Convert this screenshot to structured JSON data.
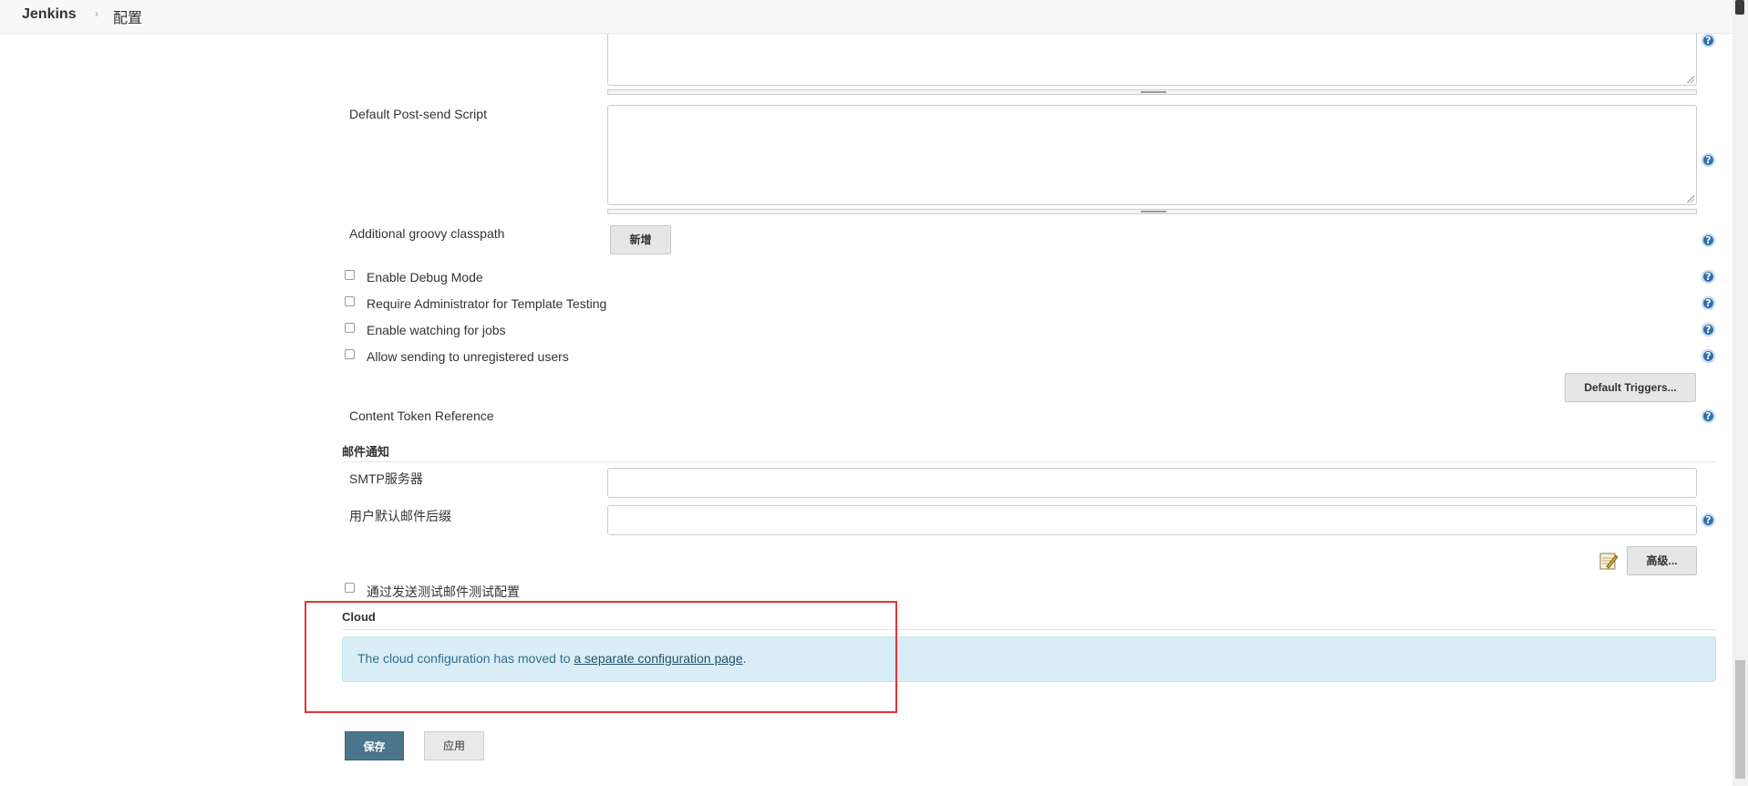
{
  "breadcrumb": {
    "root": "Jenkins",
    "separator": "›",
    "current": "配置"
  },
  "fields": {
    "post_send_script_label": "Default Post-send Script",
    "groovy_classpath_label": "Additional groovy classpath",
    "groovy_add_button": "新增",
    "content_token_label": "Content Token Reference",
    "default_triggers_button": "Default Triggers..."
  },
  "checkboxes": {
    "debug": "Enable Debug Mode",
    "admin_template": "Require Administrator for Template Testing",
    "watching": "Enable watching for jobs",
    "unregistered": "Allow sending to unregistered users"
  },
  "email_section": {
    "header": "邮件通知",
    "smtp_label": "SMTP服务器",
    "smtp_value": "",
    "suffix_label": "用户默认邮件后缀",
    "suffix_value": "",
    "advanced_button": "高级...",
    "test_checkbox": "通过发送测试邮件测试配置"
  },
  "cloud_section": {
    "header": "Cloud",
    "message": "The cloud configuration has moved to ",
    "link_text": "a separate configuration page",
    "message_end": "."
  },
  "actions": {
    "save": "保存",
    "apply": "应用"
  },
  "help_icon_glyph": "?",
  "colors": {
    "save_button": "#4b758b",
    "info_background": "#d9edf7",
    "highlight_border": "#e53333",
    "help_icon": "#2f6fb0"
  }
}
